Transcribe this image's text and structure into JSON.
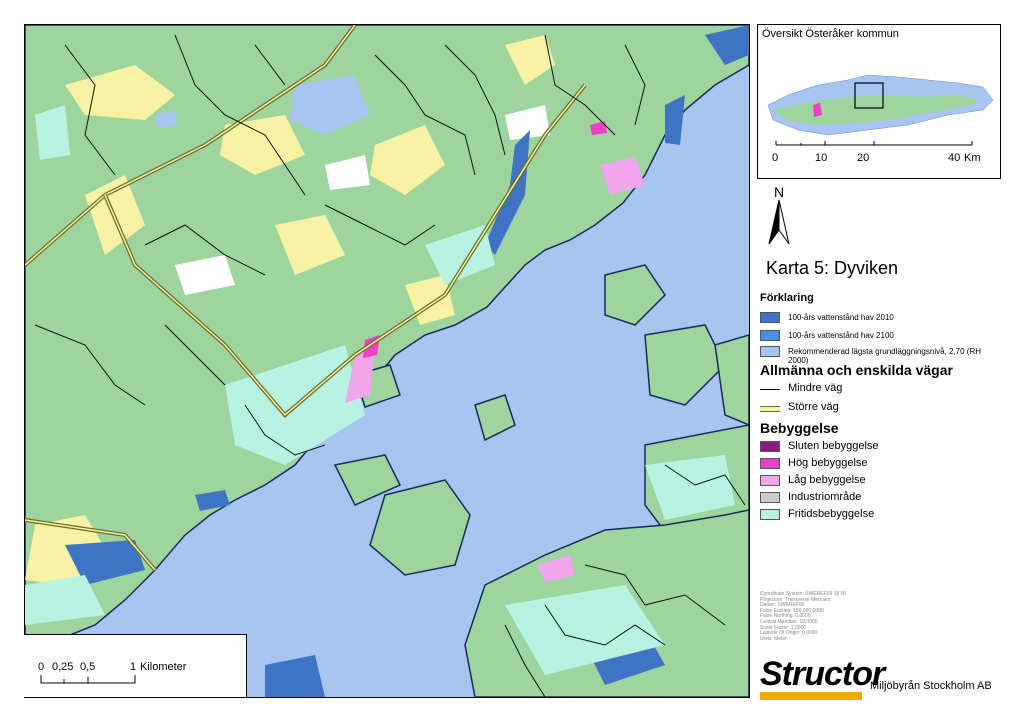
{
  "map": {
    "title": "Karta 5: Dyviken",
    "colors": {
      "water": "#a8c4f0",
      "land": "#9ed59e",
      "open_land": "#f7f2a3",
      "flood_2010": "#3f74c4",
      "flood_2100": "#4a90e2",
      "foundation_level": "#a8c4f0",
      "holiday_housing": "#b8f2e0",
      "low_housing": "#f2a6ee",
      "high_housing": "#ee3fc9",
      "closed_housing": "#8d1a7f",
      "industrial": "#cccccc"
    }
  },
  "scalebar": {
    "ticks": [
      "0",
      "0,25",
      "0,5",
      "1"
    ],
    "unit": "Kilometer"
  },
  "overview": {
    "title": "Översikt Österåker kommun",
    "ticks": [
      "0",
      "10",
      "20",
      "40"
    ],
    "unit": "Km"
  },
  "north_arrow": {
    "label": "N"
  },
  "legend": {
    "heading": "Förklaring",
    "water_levels": [
      {
        "label": "100-års vattenstånd hav 2010",
        "color": "#3f74c4"
      },
      {
        "label": "100-års vattenstånd hav 2100",
        "color": "#4a90e2"
      },
      {
        "label": "Rekommenderad lägsta grundläggningsnivå, 2,70 (RH 2000)",
        "color": "#a8c4f0"
      }
    ],
    "roads": {
      "heading": "Allmänna och enskilda vägar",
      "items": [
        {
          "label": "Mindre väg",
          "icon": "thin-black-line"
        },
        {
          "label": "Större väg",
          "icon": "double-line-olive"
        }
      ]
    },
    "buildings": {
      "heading": "Bebyggelse",
      "items": [
        {
          "label": "Sluten bebyggelse",
          "color": "#8d1a7f"
        },
        {
          "label": "Hög bebyggelse",
          "color": "#ee3fc9"
        },
        {
          "label": "Låg bebyggelse",
          "color": "#f2a6ee"
        },
        {
          "label": "Industriområde",
          "color": "#cccccc"
        },
        {
          "label": "Fritidsbebyggelse",
          "color": "#b8f2e0"
        }
      ]
    }
  },
  "metadata": [
    "Coordinate System: SWEREF99 18 00",
    "Projection: Transverse Mercator",
    "Datum: SWEREF99",
    "False Easting: 150 000,0000",
    "False Northing: 0,0000",
    "Central Meridian: 18,0000",
    "Scale Factor: 1,0000",
    "Latitude Of Origin: 0,0000",
    "Units: Meter"
  ],
  "branding": {
    "logo_text": "Structor",
    "company": "Miljöbyrån Stockholm AB"
  }
}
